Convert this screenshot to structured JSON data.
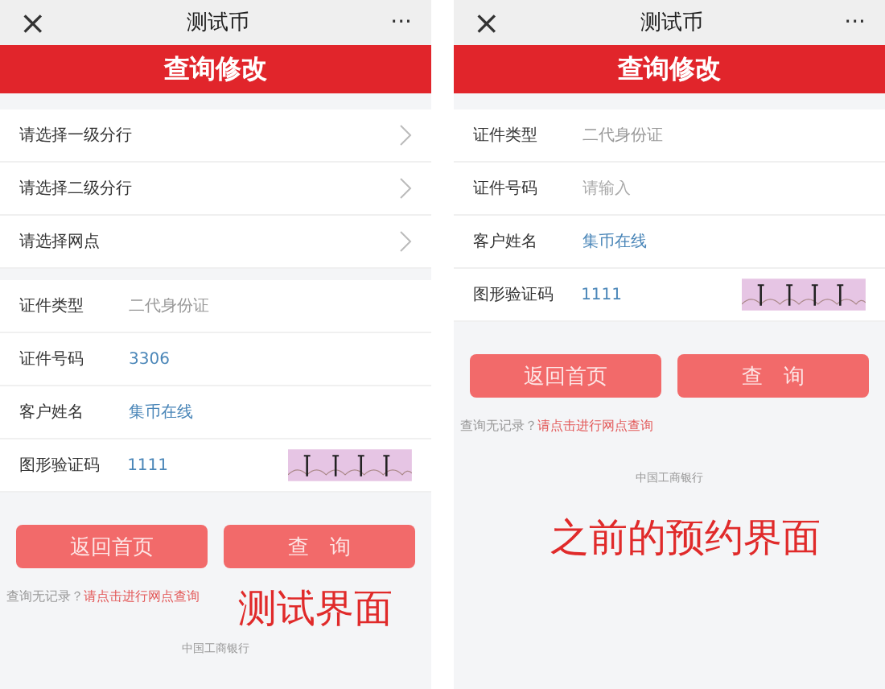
{
  "screens": [
    {
      "title": "测试币",
      "menu": "···",
      "close": "×",
      "banner": "查询修改",
      "selects": [
        {
          "label": "请选择一级分行"
        },
        {
          "label": "请选择二级分行"
        },
        {
          "label": "请选择网点"
        }
      ],
      "fields": [
        {
          "kind": "select",
          "label": "证件类型",
          "value": "二代身份证"
        },
        {
          "kind": "input",
          "label": "证件号码",
          "value": "3306"
        },
        {
          "kind": "input",
          "label": "客户姓名",
          "value": "集币在线"
        },
        {
          "kind": "captcha",
          "label": "图形验证码",
          "value": "1111"
        }
      ],
      "buttons": [
        "返回首页",
        "查　询"
      ],
      "hint": {
        "text": "查询无记录？",
        "link": "请点击进行网点查询"
      },
      "footer": "中国工商银行",
      "annotation": "测试界面"
    },
    {
      "title": "测试币",
      "menu": "···",
      "close": "×",
      "banner": "查询修改",
      "fields": [
        {
          "kind": "select",
          "label": "证件类型",
          "value": "二代身份证"
        },
        {
          "kind": "input",
          "label": "证件号码",
          "placeholder": "请输入"
        },
        {
          "kind": "input",
          "label": "客户姓名",
          "value": "集币在线"
        },
        {
          "kind": "captcha",
          "label": "图形验证码",
          "value": "1111"
        }
      ],
      "buttons": [
        "返回首页",
        "查　询"
      ],
      "hint": {
        "text": "查询无记录？",
        "link": "请点击进行网点查询"
      },
      "footer": "中国工商银行",
      "annotation": "之前的预约界面"
    }
  ]
}
